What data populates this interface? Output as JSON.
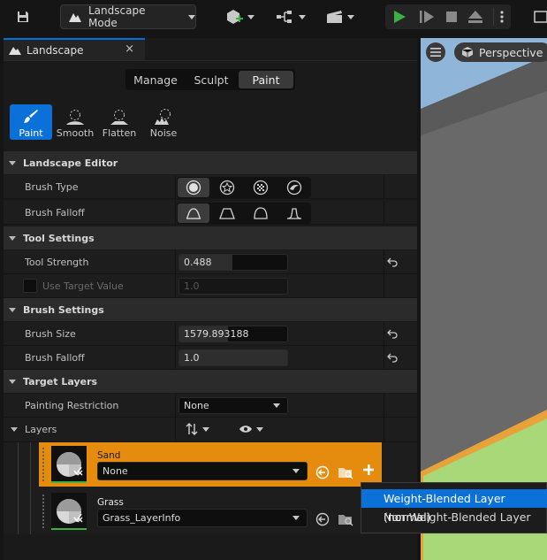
{
  "toolbar": {
    "mode_label": "Landscape Mode",
    "icons": [
      "save-icon",
      "landscape-mode-icon",
      "add-actor-icon",
      "blueprint-icon",
      "cinematics-icon",
      "play-icon",
      "advance-frame-icon",
      "stop-icon",
      "eject-icon",
      "more-icon"
    ]
  },
  "panel": {
    "tab_title": "Landscape",
    "close_glyph": "×",
    "modes": [
      "Manage",
      "Sculpt",
      "Paint"
    ],
    "active_mode": "Paint",
    "tools": [
      {
        "label": "Paint",
        "icon": "paint-brush-icon",
        "active": true
      },
      {
        "label": "Smooth",
        "icon": "smooth-icon",
        "active": false
      },
      {
        "label": "Flatten",
        "icon": "flatten-icon",
        "active": false
      },
      {
        "label": "Noise",
        "icon": "noise-icon",
        "active": false
      }
    ]
  },
  "landscape_editor": {
    "header": "Landscape Editor",
    "brush_type_label": "Brush Type",
    "brush_falloff_label": "Brush Falloff"
  },
  "tool_settings": {
    "header": "Tool Settings",
    "tool_strength_label": "Tool Strength",
    "tool_strength_value": "0.488",
    "tool_strength_fraction": 0.488,
    "use_target_label": "Use Target Value",
    "use_target_value": "1.0"
  },
  "brush_settings": {
    "header": "Brush Settings",
    "brush_size_label": "Brush Size",
    "brush_size_value": "1579.893188",
    "brush_size_fill": 0.45,
    "brush_falloff_label": "Brush Falloff",
    "brush_falloff_value": "1.0",
    "brush_falloff_fill": 1.0
  },
  "target_layers": {
    "header": "Target Layers",
    "painting_restriction_label": "Painting Restriction",
    "painting_restriction_value": "None",
    "layers_label": "Layers",
    "layers": [
      {
        "name": "Sand",
        "info": "None",
        "selected": true
      },
      {
        "name": "Grass",
        "info": "Grass_LayerInfo",
        "selected": false
      }
    ]
  },
  "popup_menu": {
    "items": [
      "Weight-Blended Layer (normal)",
      "Non Weight-Blended Layer"
    ],
    "highlighted": 0
  },
  "viewport": {
    "perspective_label": "Perspective"
  },
  "colors": {
    "accent": "#0b70d8",
    "selected_layer": "#e58b0d",
    "play_green": "#3cb043",
    "viewport_grass": "#a8d878"
  }
}
